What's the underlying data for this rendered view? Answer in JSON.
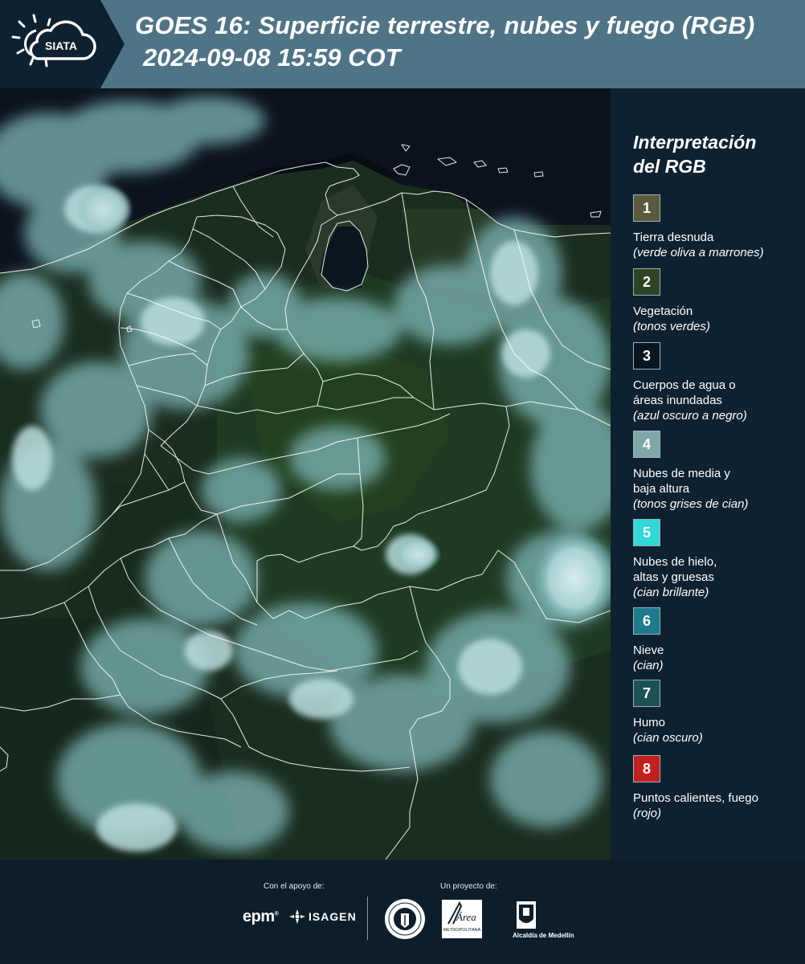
{
  "header": {
    "logo_text": "SIATA",
    "title_line1": "GOES 16: Superficie terrestre, nubes y fuego (RGB)",
    "title_line2": "2024-09-08 15:59 COT"
  },
  "legend": {
    "title_line1": "Interpretación",
    "title_line2": "del RGB",
    "items": [
      {
        "number": "1",
        "color": "#5b5a3f",
        "lines": [
          "Tierra desnuda"
        ],
        "sub": "(verde oliva a marrones)"
      },
      {
        "number": "2",
        "color": "#2f4424",
        "lines": [
          "Vegetación"
        ],
        "sub": "(tonos verdes)"
      },
      {
        "number": "3",
        "color": "#0b1520",
        "lines": [
          "Cuerpos de agua o",
          "áreas inundadas"
        ],
        "sub": "(azul oscuro a negro)"
      },
      {
        "number": "4",
        "color": "#7ea8a7",
        "lines": [
          "Nubes de media y",
          "baja altura"
        ],
        "sub": "(tonos grises de cian)"
      },
      {
        "number": "5",
        "color": "#30d8d8",
        "lines": [
          "Nubes de hielo,",
          "altas y gruesas"
        ],
        "sub": "(cian brillante)"
      },
      {
        "number": "6",
        "color": "#1f7a8c",
        "lines": [
          "Nieve"
        ],
        "sub": "(cian)"
      },
      {
        "number": "7",
        "color": "#1d5253",
        "lines": [
          "Humo"
        ],
        "sub": "(cian oscuro)"
      },
      {
        "number": "8",
        "color": "#c0201f",
        "lines": [
          "Puntos calientes, fuego"
        ],
        "sub": "(rojo)"
      }
    ]
  },
  "footer": {
    "support_label": "Con el apoyo de:",
    "project_label": "Un proyecto de:",
    "epm": "epm",
    "isagen": "ISAGEN",
    "area_text": "Área",
    "area_sub": "METROPOLITANA",
    "alcaldia": "Alcaldía de Medellín"
  },
  "colors": {
    "header_bg": "#4f7486",
    "logo_bg": "#0e2130",
    "legend_bg": "#0e2130",
    "footer_bg": "#0d1e2a",
    "border_lines": "#ffffff",
    "vegetation": "#1f3320",
    "clouds": "#8ecbcb"
  }
}
